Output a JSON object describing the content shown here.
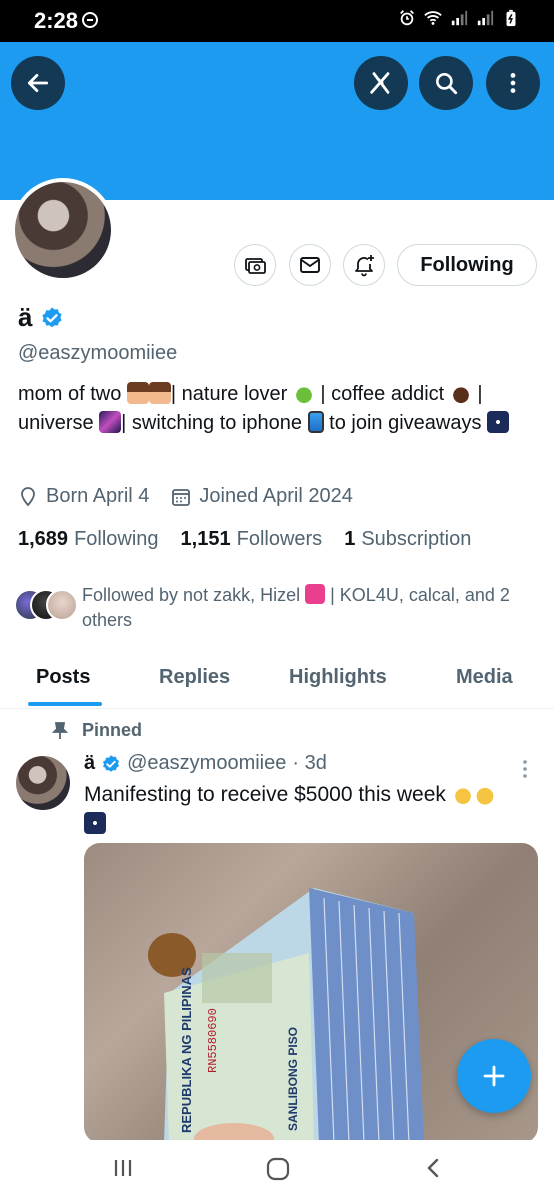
{
  "status_bar": {
    "time": "2:28"
  },
  "header": {
    "banner_color": "#1d9bf0",
    "accent": "#1d9bf0"
  },
  "profile": {
    "display_name": "ä",
    "verified": true,
    "handle": "@easzymoomiiee",
    "bio": {
      "part1": "mom of two",
      "part2": "| nature lover",
      "part3": "| coffee addict",
      "part4": "| universe",
      "part5": "| switching to iphone",
      "part6": "to join giveaways"
    },
    "born": "Born April 4",
    "joined": "Joined April 2024",
    "following_count": "1,689",
    "following_label": "Following",
    "followers_count": "1,151",
    "followers_label": "Followers",
    "subscription_count": "1",
    "subscription_label": "Subscription",
    "followed_by_a": "Followed by not zakk, Hizel",
    "followed_by_b": "| KOL4U, calcal, and 2 others"
  },
  "actions": {
    "following_button": "Following"
  },
  "tabs": [
    {
      "label": "Posts",
      "active": true
    },
    {
      "label": "Replies",
      "active": false
    },
    {
      "label": "Highlights",
      "active": false
    },
    {
      "label": "Media",
      "active": false
    }
  ],
  "pinned_post": {
    "pinned_label": "Pinned",
    "author_name": "ä",
    "author_handle": "@easzymoomiiee",
    "time": "· 3d",
    "text": "Manifesting to receive $5000 this week"
  },
  "image_text": {
    "bank": "REPUBLIKA NG PILIPINAS",
    "denomination": "SANLIBONG PISO",
    "serial": "RN5580690"
  }
}
